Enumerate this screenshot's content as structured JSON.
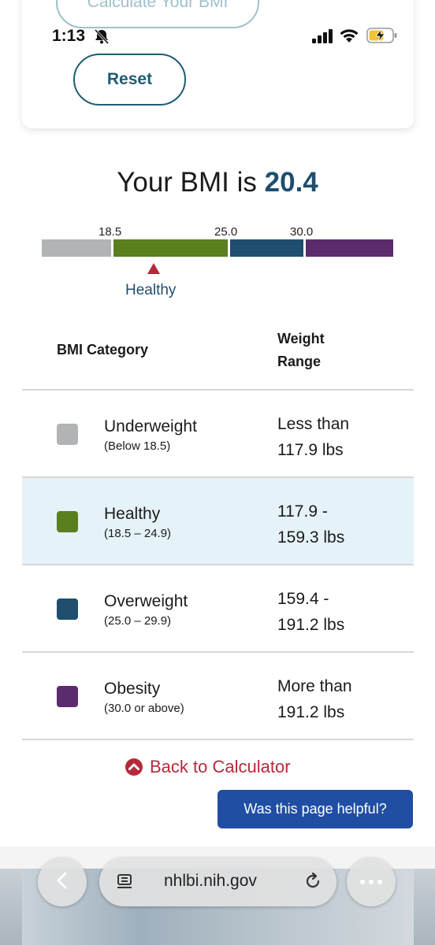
{
  "status_bar": {
    "time": "1:13",
    "icons": [
      "bell-slash-icon",
      "cellular-signal-icon",
      "wifi-icon",
      "battery-charging-icon"
    ]
  },
  "form_card": {
    "calculate_label": "Calculate Your BMI",
    "reset_label": "Reset"
  },
  "result": {
    "prefix": "Your BMI is",
    "value": "20.4"
  },
  "scale": {
    "ticks": [
      "18.5",
      "25.0",
      "30.0"
    ],
    "marker_label": "Healthy",
    "colors": [
      "#b1b3b6",
      "#5a7f1f",
      "#1f4e6e",
      "#5b2b6e"
    ]
  },
  "table": {
    "header_category": "BMI Category",
    "header_weight": "Weight Range",
    "rows": [
      {
        "name": "Underweight",
        "range": "(Below 18.5)",
        "weight_line1": "Less than",
        "weight_line2": "117.9 lbs",
        "color": "#b1b3b6"
      },
      {
        "name": "Healthy",
        "range": "(18.5 – 24.9)",
        "weight_line1": "117.9 -",
        "weight_line2": "159.3 lbs",
        "color": "#5a7f1f"
      },
      {
        "name": "Overweight",
        "range": "(25.0 – 29.9)",
        "weight_line1": "159.4 -",
        "weight_line2": "191.2 lbs",
        "color": "#1f4e6e"
      },
      {
        "name": "Obesity",
        "range": "(30.0 or above)",
        "weight_line1": "More than",
        "weight_line2": "191.2 lbs",
        "color": "#5b2b6e"
      }
    ]
  },
  "back_link": "Back to Calculator",
  "helpful_button": "Was this page helpful?",
  "browser": {
    "url": "nhlbi.nih.gov"
  }
}
